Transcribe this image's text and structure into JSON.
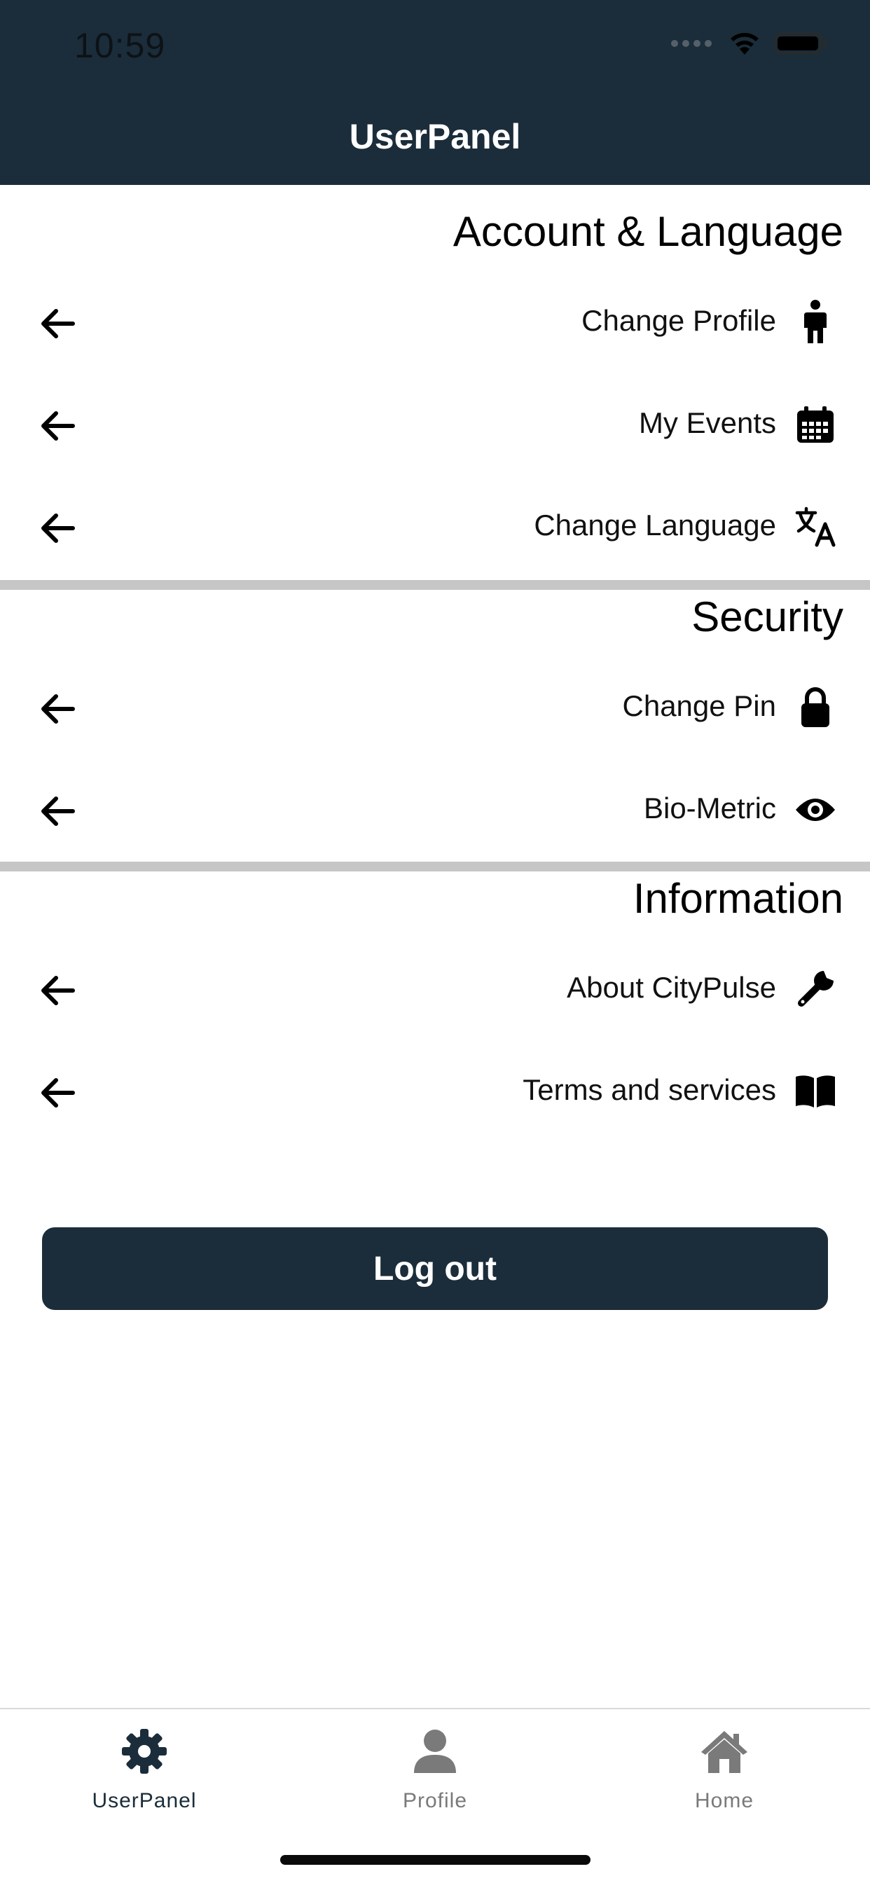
{
  "status_bar": {
    "time": "10:59"
  },
  "header": {
    "title": "UserPanel"
  },
  "sections": [
    {
      "title": "Account & Language",
      "items": [
        {
          "label": "Change Profile",
          "icon": "person-icon"
        },
        {
          "label": "My Events",
          "icon": "calendar-icon"
        },
        {
          "label": "Change Language",
          "icon": "translate-icon"
        }
      ]
    },
    {
      "title": "Security",
      "items": [
        {
          "label": "Change Pin",
          "icon": "lock-icon"
        },
        {
          "label": "Bio-Metric",
          "icon": "eye-icon"
        }
      ]
    },
    {
      "title": "Information",
      "items": [
        {
          "label": "About CityPulse",
          "icon": "wrench-icon"
        },
        {
          "label": "Terms and services",
          "icon": "book-icon"
        }
      ]
    }
  ],
  "logout": {
    "label": "Log out"
  },
  "tabbar": {
    "tabs": [
      {
        "label": "UserPanel",
        "icon": "gear-icon",
        "active": true
      },
      {
        "label": "Profile",
        "icon": "person-icon",
        "active": false
      },
      {
        "label": "Home",
        "icon": "home-icon",
        "active": false
      }
    ]
  },
  "colors": {
    "primary": "#1b2d3a",
    "divider": "#c6c6c6",
    "inactive": "#7a7a7a"
  }
}
